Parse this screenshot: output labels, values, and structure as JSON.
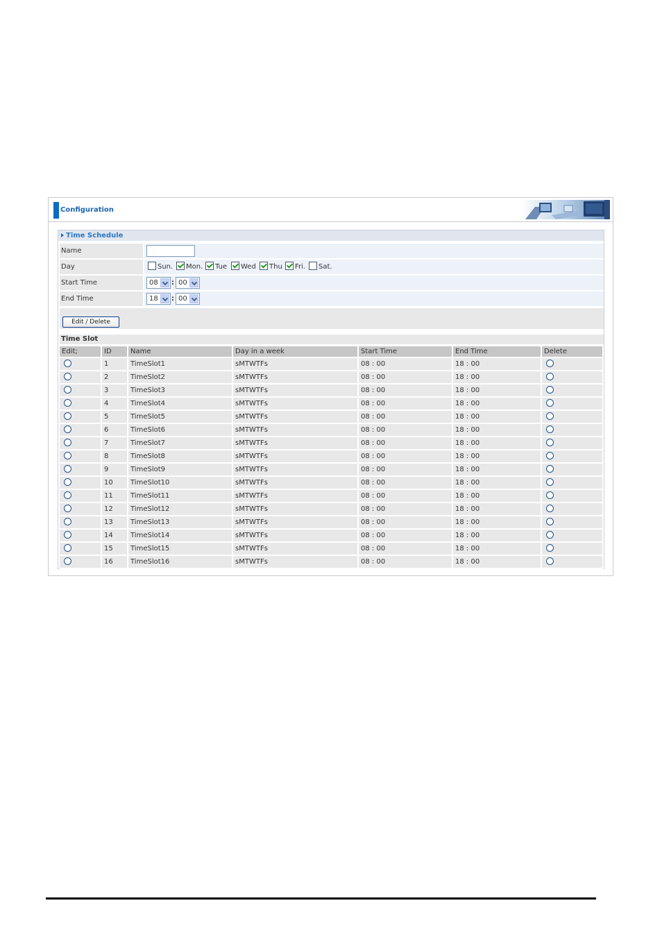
{
  "header": {
    "title": "Configuration"
  },
  "schedule": {
    "title": "Time Schedule",
    "name_label": "Name",
    "name_value": "",
    "day_label": "Day",
    "days": [
      {
        "label": "Sun.",
        "checked": false
      },
      {
        "label": "Mon.",
        "checked": true
      },
      {
        "label": "Tue",
        "checked": true
      },
      {
        "label": "Wed",
        "checked": true
      },
      {
        "label": "Thu",
        "checked": true
      },
      {
        "label": "Fri.",
        "checked": true
      },
      {
        "label": "Sat.",
        "checked": false
      }
    ],
    "start_label": "Start Time",
    "start_hour": "08",
    "start_min": "00",
    "end_label": "End Time",
    "end_hour": "18",
    "end_min": "00",
    "colon": ":",
    "edit_delete_label": "Edit / Delete"
  },
  "timeslot": {
    "title": "Time Slot",
    "columns": [
      "Edit;",
      "ID",
      "Name",
      "Day in a week",
      "Start Time",
      "End Time",
      "Delete"
    ],
    "rows": [
      {
        "id": "1",
        "name": "TimeSlot1",
        "days": "sMTWTFs",
        "start": "08 : 00",
        "end": "18 : 00"
      },
      {
        "id": "2",
        "name": "TimeSlot2",
        "days": "sMTWTFs",
        "start": "08 : 00",
        "end": "18 : 00"
      },
      {
        "id": "3",
        "name": "TimeSlot3",
        "days": "sMTWTFs",
        "start": "08 : 00",
        "end": "18 : 00"
      },
      {
        "id": "4",
        "name": "TimeSlot4",
        "days": "sMTWTFs",
        "start": "08 : 00",
        "end": "18 : 00"
      },
      {
        "id": "5",
        "name": "TimeSlot5",
        "days": "sMTWTFs",
        "start": "08 : 00",
        "end": "18 : 00"
      },
      {
        "id": "6",
        "name": "TimeSlot6",
        "days": "sMTWTFs",
        "start": "08 : 00",
        "end": "18 : 00"
      },
      {
        "id": "7",
        "name": "TimeSlot7",
        "days": "sMTWTFs",
        "start": "08 : 00",
        "end": "18 : 00"
      },
      {
        "id": "8",
        "name": "TimeSlot8",
        "days": "sMTWTFs",
        "start": "08 : 00",
        "end": "18 : 00"
      },
      {
        "id": "9",
        "name": "TimeSlot9",
        "days": "sMTWTFs",
        "start": "08 : 00",
        "end": "18 : 00"
      },
      {
        "id": "10",
        "name": "TimeSlot10",
        "days": "sMTWTFs",
        "start": "08 : 00",
        "end": "18 : 00"
      },
      {
        "id": "11",
        "name": "TimeSlot11",
        "days": "sMTWTFs",
        "start": "08 : 00",
        "end": "18 : 00"
      },
      {
        "id": "12",
        "name": "TimeSlot12",
        "days": "sMTWTFs",
        "start": "08 : 00",
        "end": "18 : 00"
      },
      {
        "id": "13",
        "name": "TimeSlot13",
        "days": "sMTWTFs",
        "start": "08 : 00",
        "end": "18 : 00"
      },
      {
        "id": "14",
        "name": "TimeSlot14",
        "days": "sMTWTFs",
        "start": "08 : 00",
        "end": "18 : 00"
      },
      {
        "id": "15",
        "name": "TimeSlot15",
        "days": "sMTWTFs",
        "start": "08 : 00",
        "end": "18 : 00"
      },
      {
        "id": "16",
        "name": "TimeSlot16",
        "days": "sMTWTFs",
        "start": "08 : 00",
        "end": "18 : 00"
      }
    ]
  },
  "colors": {
    "accent": "#0a6cc2",
    "title_text": "#2a78c6",
    "row_bg": "#e8e8e8",
    "header_bg": "#c6c6c6"
  }
}
